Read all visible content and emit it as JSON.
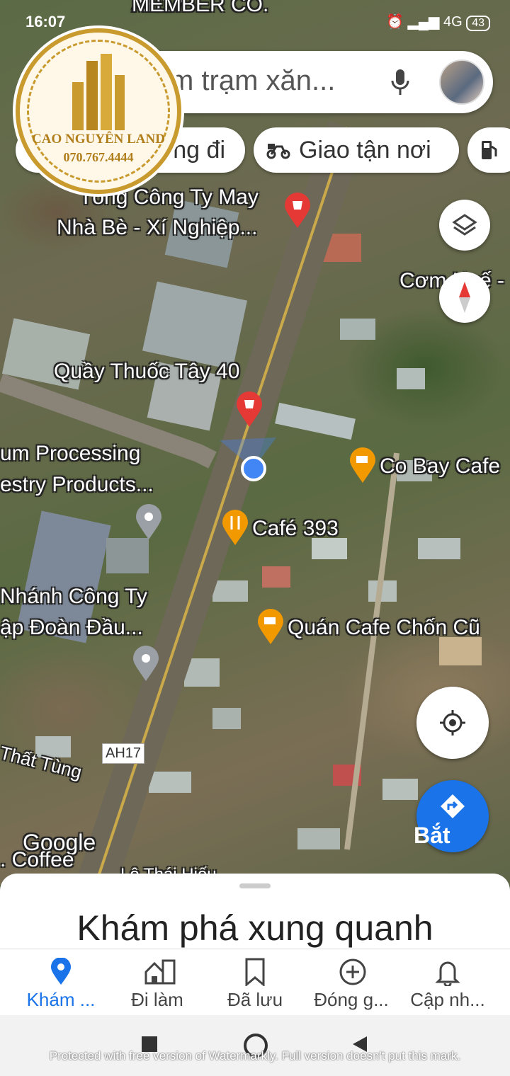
{
  "status_bar": {
    "time": "16:07",
    "network": "4G",
    "battery": "43"
  },
  "logo": {
    "name": "CAO NGUYÊN LAND",
    "phone": "070.767.4444"
  },
  "search": {
    "query": "m trạm xăn..."
  },
  "chips": [
    {
      "label": "ng đi"
    },
    {
      "label": "Giao tận nơi"
    }
  ],
  "top_label": "MEMBER CO.",
  "map_labels": {
    "tong_cong_ty_1": "Tổng Công Ty May",
    "tong_cong_ty_2": "Nhà Bè - Xí Nghiệp...",
    "com_hue": "Cơm Huế -",
    "quay_thuoc": "Quầy Thuốc Tây 40",
    "processing_1": "um Processing",
    "processing_2": "estry Products...",
    "co_bay": "Co Bay Cafe",
    "cafe_393": "Café 393",
    "chi_nhanh_1": "Nhánh Công Ty",
    "chi_nhanh_2": "ập Đoàn Đầu...",
    "quan_cafe": "Quán Cafe Chốn Cũ",
    "that_tung": "Thất Tùng",
    "road_sign": "AH17",
    "road_sign_top": "AH17",
    "google": "Google",
    "coffee": ". Coffee",
    "street_bottom": "Lê Thái Hiếu"
  },
  "directions_label": "Bắt",
  "sheet": {
    "title": "Khám phá xung quanh"
  },
  "bottom_nav": [
    {
      "label": "Khám ...",
      "icon": "location-pin-icon",
      "active": true
    },
    {
      "label": "Đi làm",
      "icon": "commute-building-icon",
      "active": false
    },
    {
      "label": "Đã lưu",
      "icon": "bookmark-icon",
      "active": false
    },
    {
      "label": "Đóng g...",
      "icon": "add-circle-icon",
      "active": false
    },
    {
      "label": "Cập nh...",
      "icon": "bell-icon",
      "active": false
    }
  ],
  "watermark": "Protected with free version of Watermarkly. Full version doesn't put this mark.",
  "colors": {
    "accent": "#1a73e8",
    "pin_red": "#e53935",
    "pin_orange": "#f29900",
    "pin_gray": "#9aa0a6"
  }
}
